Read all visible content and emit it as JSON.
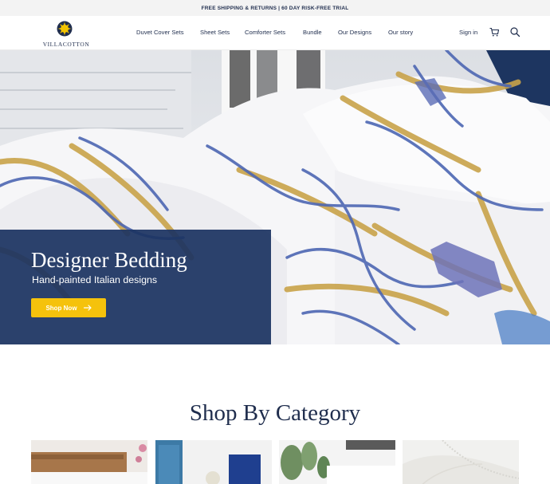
{
  "announcement": "FREE SHIPPING & RETURNS | 60 DAY RISK-FREE TRIAL",
  "brand": {
    "name": "VILLACOTTON",
    "icon": "sun-logo-icon"
  },
  "nav": [
    {
      "label": "Duvet Cover Sets"
    },
    {
      "label": "Sheet Sets"
    },
    {
      "label": "Comforter Sets"
    },
    {
      "label": "Bundle"
    },
    {
      "label": "Our Designs"
    },
    {
      "label": "Our story"
    }
  ],
  "header_actions": {
    "signin": "Sign in",
    "cart_icon": "cart-icon",
    "search_icon": "search-icon"
  },
  "hero": {
    "title": "Designer Bedding",
    "subtitle": "Hand-painted Italian designs",
    "cta": "Shop Now",
    "cta_icon": "arrow-right-icon"
  },
  "shop_by_category": {
    "title": "Shop By Category",
    "cards": [
      {
        "image": "bedroom-wood-headboard"
      },
      {
        "image": "blue-door-chair"
      },
      {
        "image": "plant-and-pillows"
      },
      {
        "image": "white-sheet-detail"
      }
    ]
  },
  "colors": {
    "navy": "#1f2d4d",
    "panel": "#1c3462",
    "cta": "#f5c20c",
    "topbar": "#f3f3f3"
  }
}
